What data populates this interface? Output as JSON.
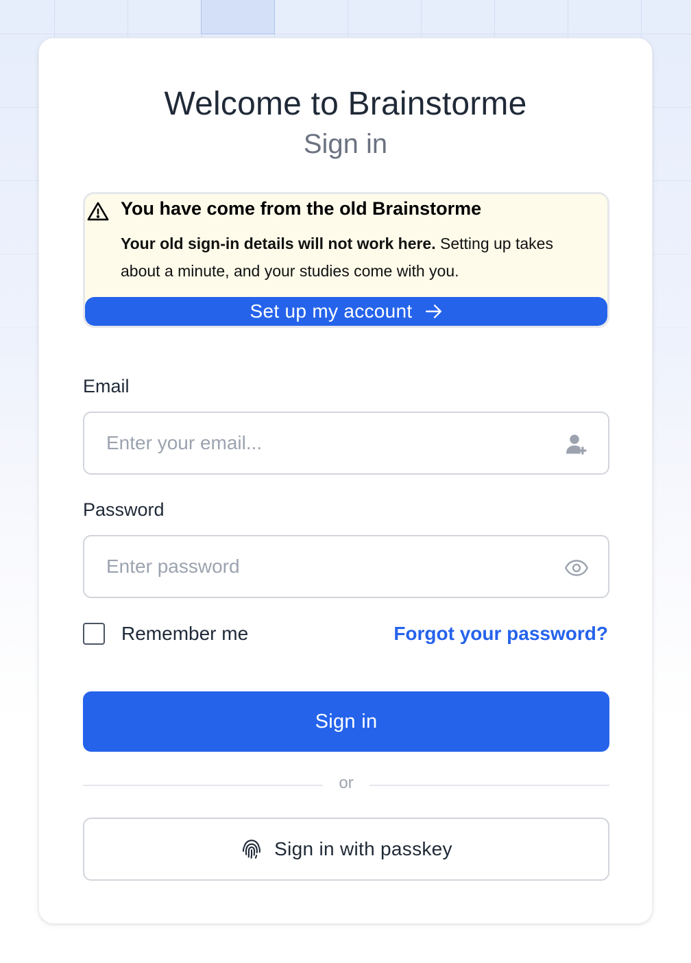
{
  "header": {
    "title": "Welcome to Brainstorme",
    "subtitle": "Sign in"
  },
  "notice": {
    "icon": "warning-icon",
    "title": "You have come from the old Brainstorme",
    "body_bold": "Your old sign-in details will not work here.",
    "body_rest": " Setting up takes about a minute, and your studies come with you.",
    "button_label": "Set up my account",
    "button_icon": "arrow-right-icon",
    "background_color": "#fefbea"
  },
  "form": {
    "email": {
      "label": "Email",
      "placeholder": "Enter your email...",
      "value": "",
      "icon": "user-plus-icon"
    },
    "password": {
      "label": "Password",
      "placeholder": "Enter password",
      "value": "",
      "icon": "eye-icon"
    },
    "remember_me": {
      "label": "Remember me",
      "checked": false
    },
    "forgot_password": "Forgot your password?",
    "submit_label": "Sign in",
    "divider_text": "or",
    "passkey_label": "Sign in with passkey",
    "passkey_icon": "fingerprint-icon"
  },
  "colors": {
    "accent": "#2563eb",
    "text": "#1f2937",
    "muted": "#6b7280",
    "border": "#d1d5db"
  }
}
